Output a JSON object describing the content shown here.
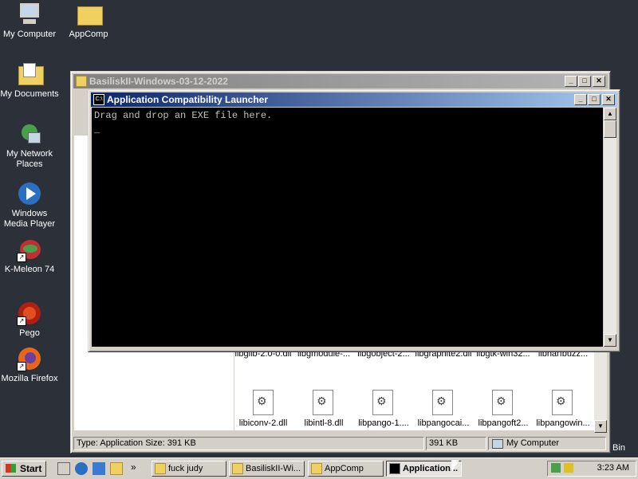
{
  "desktop": {
    "icons": [
      {
        "label": "My Computer"
      },
      {
        "label": "AppComp"
      },
      {
        "label": "My Documents"
      },
      {
        "label": "My Network Places"
      },
      {
        "label": "Windows Media Player"
      },
      {
        "label": "K-Meleon 74"
      },
      {
        "label": "Pego"
      },
      {
        "label": "Mozilla Firefox"
      },
      {
        "label": "Bin"
      }
    ]
  },
  "explorer": {
    "title": "BasiliskII-Windows-03-12-2022",
    "files": [
      "libglib-2.0-0.dll",
      "libgmodule-...",
      "libgobject-2...",
      "libgraphite2.dll",
      "libgtk-win32...",
      "libharfbuzz...",
      "libiconv-2.dll",
      "libintl-8.dll",
      "libpango-1....",
      "libpangocai...",
      "libpangoft2...",
      "libpangowin..."
    ],
    "status": {
      "type_text": "Type: Application Size: 391 KB",
      "size": "391 KB",
      "location": "My Computer"
    }
  },
  "console": {
    "title": "Application Compatibility Launcher",
    "icon_text": "C:\\",
    "line1": "Drag and drop an EXE file here.",
    "cursor": "_"
  },
  "taskbar": {
    "start_label": "Start",
    "quick_launch_arrow": "»",
    "tasks": [
      {
        "label": "fuck judy"
      },
      {
        "label": "BasiliskII-Wi..."
      },
      {
        "label": "AppComp"
      },
      {
        "label": "Application..."
      }
    ],
    "clock": "3:23 AM"
  }
}
